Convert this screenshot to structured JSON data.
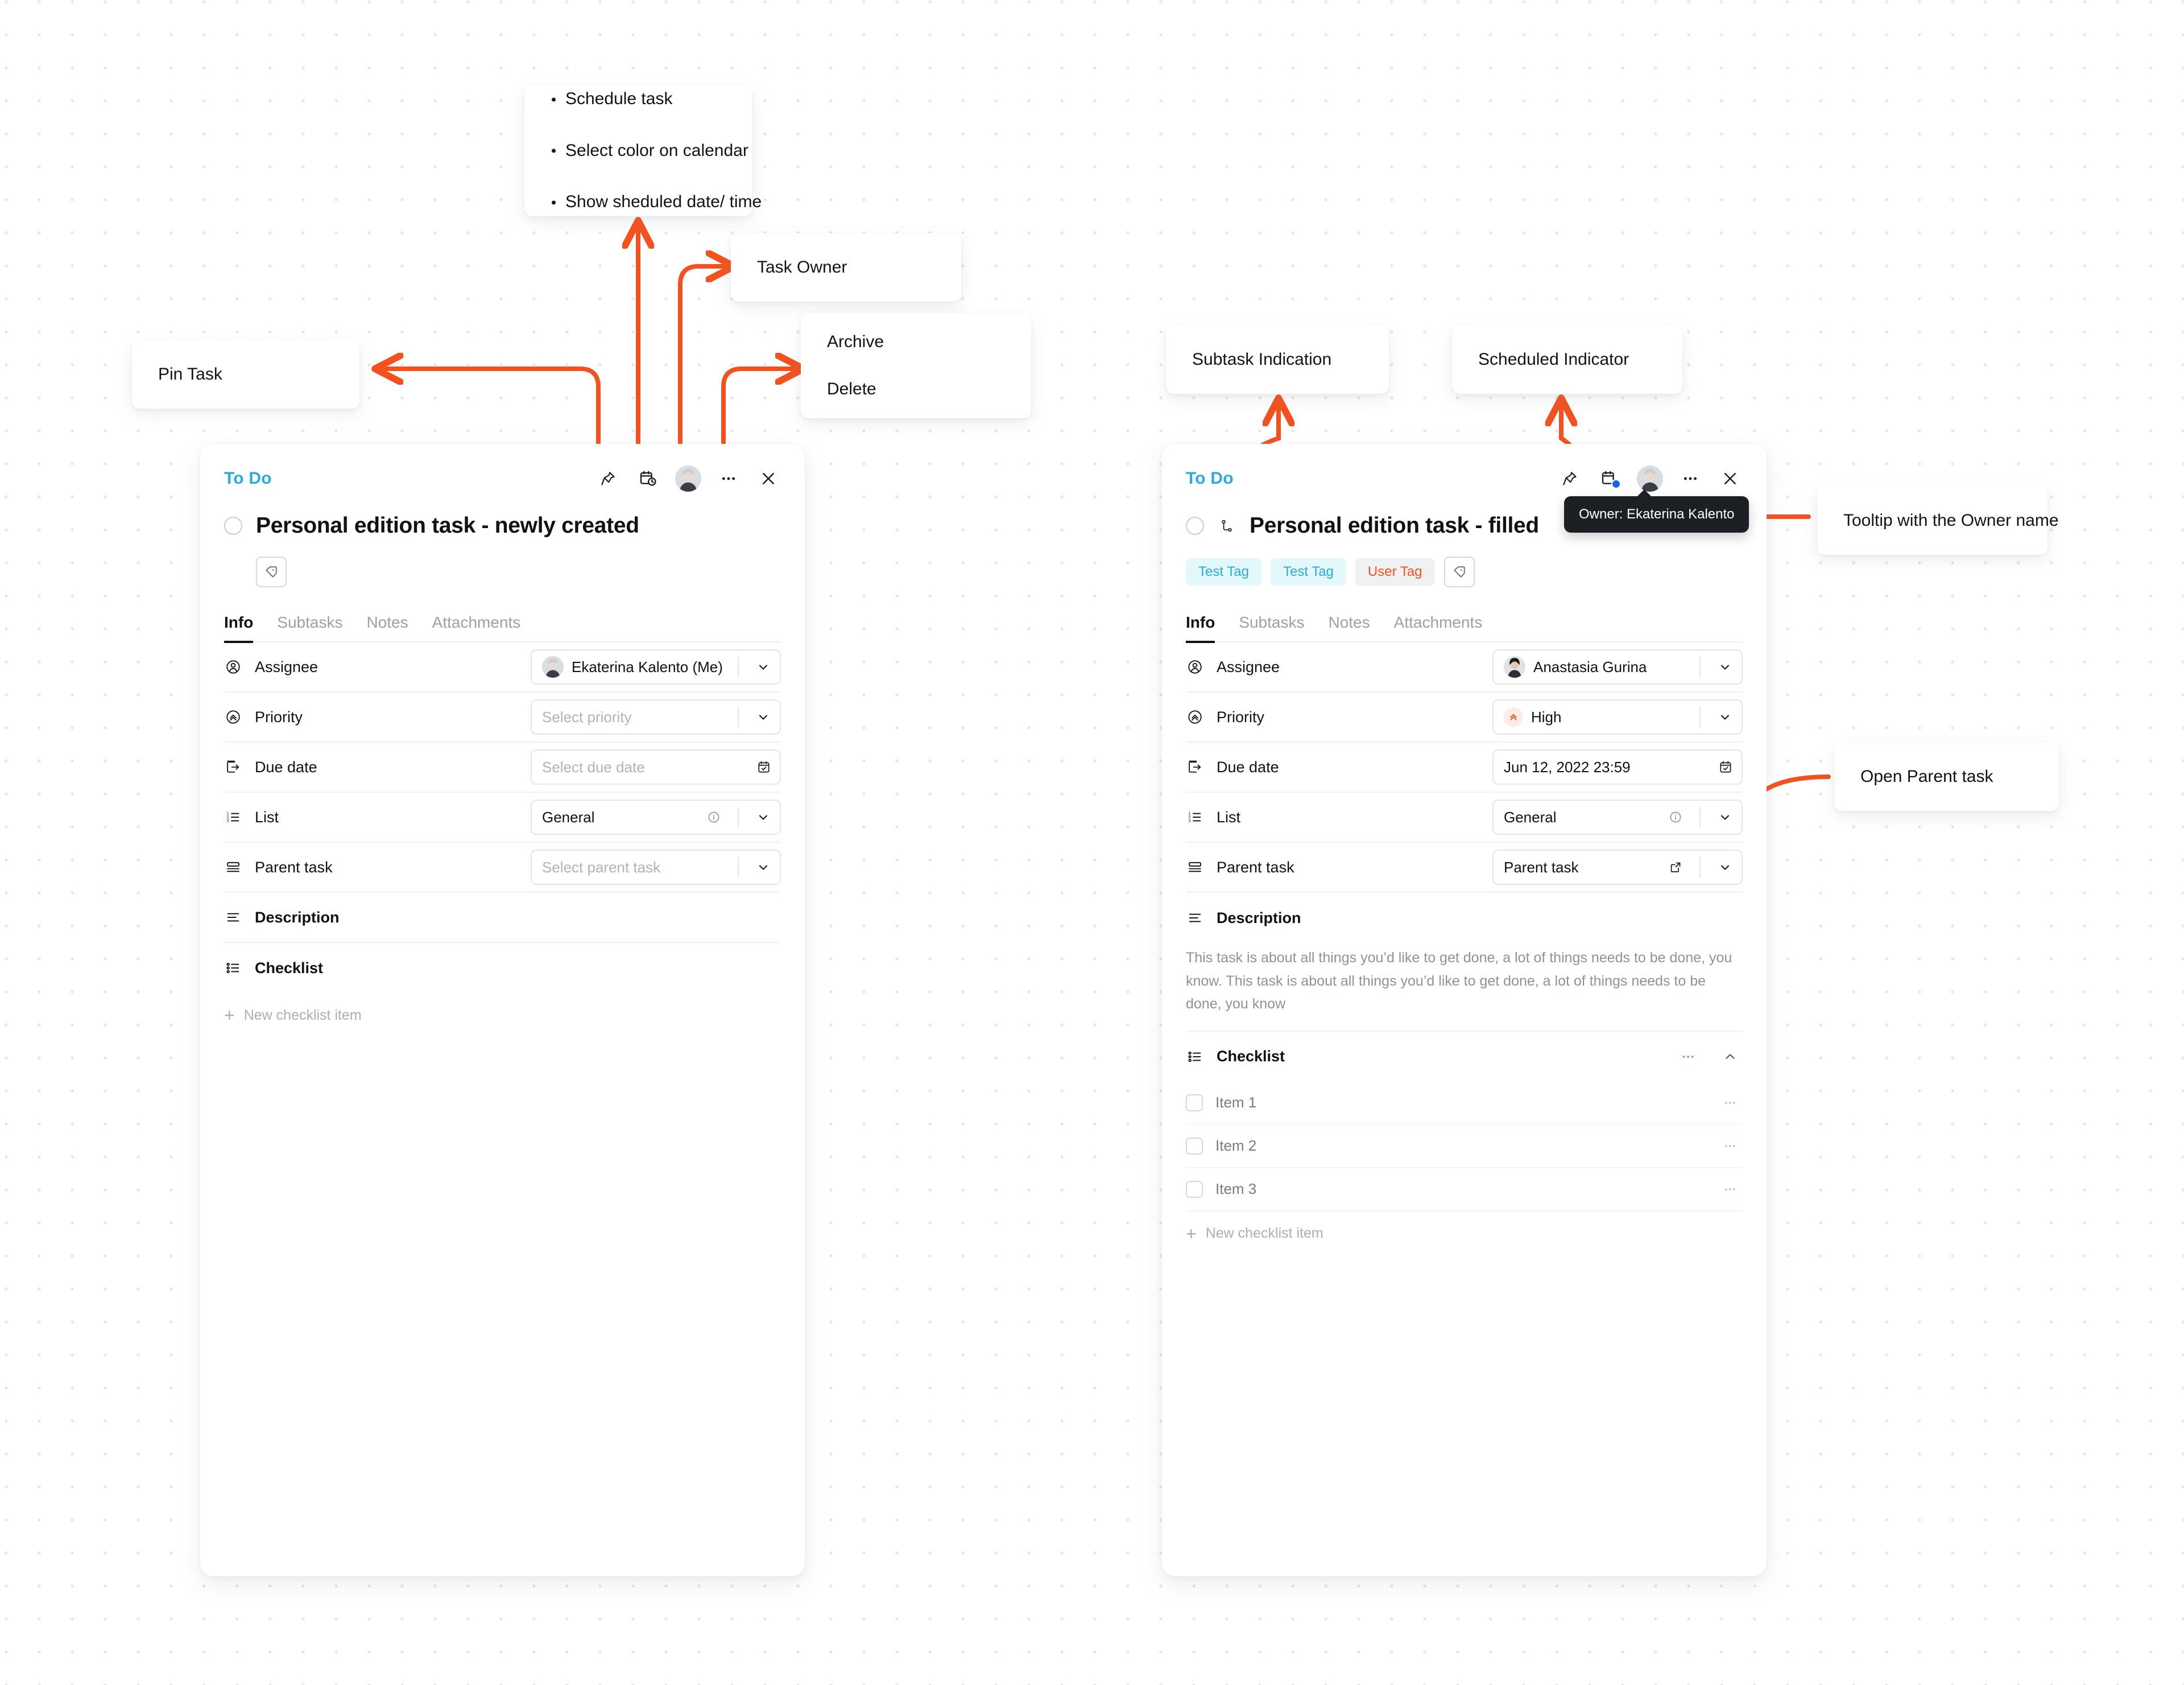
{
  "annotations": {
    "schedule_note": {
      "lines": [
        "Schedule task",
        "Select color on calendar",
        "Show sheduled date/ time"
      ]
    },
    "pin_task": "Pin Task",
    "task_owner": "Task Owner",
    "archive_delete": {
      "lines": [
        "Archive",
        "Delete"
      ]
    },
    "subtask_indication": "Subtask Indication",
    "scheduled_indicator": "Scheduled Indicator",
    "tooltip_owner_note": "Tooltip with the Owner name",
    "open_parent_task": "Open Parent task"
  },
  "colors": {
    "accent_orange": "#F4511E",
    "status_cyan": "#29ABE2",
    "scheduled_blue": "#1565F0",
    "tag_cyan_bg": "#E2F8FB",
    "tag_orange_bg": "#F0F1F3"
  },
  "left_card": {
    "status": "To Do",
    "title": "Personal edition task - newly created",
    "header_icons": [
      "pin-icon",
      "calendar-clock-icon",
      "owner-avatar",
      "more-icon",
      "close-icon"
    ],
    "tags": [],
    "tabs": [
      {
        "label": "Info",
        "active": true
      },
      {
        "label": "Subtasks",
        "active": false
      },
      {
        "label": "Notes",
        "active": false
      },
      {
        "label": "Attachments",
        "active": false
      }
    ],
    "fields": [
      {
        "label": "Assignee",
        "value": "Ekaterina Kalento (Me)",
        "placeholder": "",
        "is_placeholder": false
      },
      {
        "label": "Priority",
        "value": "",
        "placeholder": "Select priority",
        "is_placeholder": true
      },
      {
        "label": "Due date",
        "value": "",
        "placeholder": "Select due date",
        "is_placeholder": true
      },
      {
        "label": "List",
        "value": "General",
        "placeholder": "",
        "is_placeholder": false
      },
      {
        "label": "Parent task",
        "value": "",
        "placeholder": "Select parent task",
        "is_placeholder": true
      }
    ],
    "description_heading": "Description",
    "description_text": "",
    "checklist_heading": "Checklist",
    "checklist_items": [],
    "new_checklist_label": "New checklist item"
  },
  "right_card": {
    "status": "To Do",
    "title": "Personal edition task - filled",
    "header_icons": [
      "pin-icon",
      "calendar-clock-icon",
      "owner-avatar",
      "more-icon",
      "close-icon"
    ],
    "tags": [
      {
        "label": "Test Tag",
        "style": "cyan"
      },
      {
        "label": "Test Tag",
        "style": "cyan"
      },
      {
        "label": "User Tag",
        "style": "orange"
      }
    ],
    "tabs": [
      {
        "label": "Info",
        "active": true
      },
      {
        "label": "Subtasks",
        "active": false
      },
      {
        "label": "Notes",
        "active": false
      },
      {
        "label": "Attachments",
        "active": false
      }
    ],
    "fields": [
      {
        "label": "Assignee",
        "value": "Anastasia Gurina",
        "placeholder": "",
        "is_placeholder": false
      },
      {
        "label": "Priority",
        "value": "High",
        "placeholder": "",
        "is_placeholder": false
      },
      {
        "label": "Due date",
        "value": "Jun 12, 2022 23:59",
        "placeholder": "",
        "is_placeholder": false
      },
      {
        "label": "List",
        "value": "General",
        "placeholder": "",
        "is_placeholder": false
      },
      {
        "label": "Parent task",
        "value": "Parent task",
        "placeholder": "",
        "is_placeholder": false
      }
    ],
    "description_heading": "Description",
    "description_text": "This task is about all things you’d like to get done, a lot of things needs to be done, you know. This task is about all things you’d like to get done, a lot of things needs to be done, you know",
    "checklist_heading": "Checklist",
    "checklist_items": [
      "Item 1",
      "Item 2",
      "Item 3"
    ],
    "new_checklist_label": "New checklist item",
    "tooltip": "Owner: Ekaterina Kalento"
  }
}
